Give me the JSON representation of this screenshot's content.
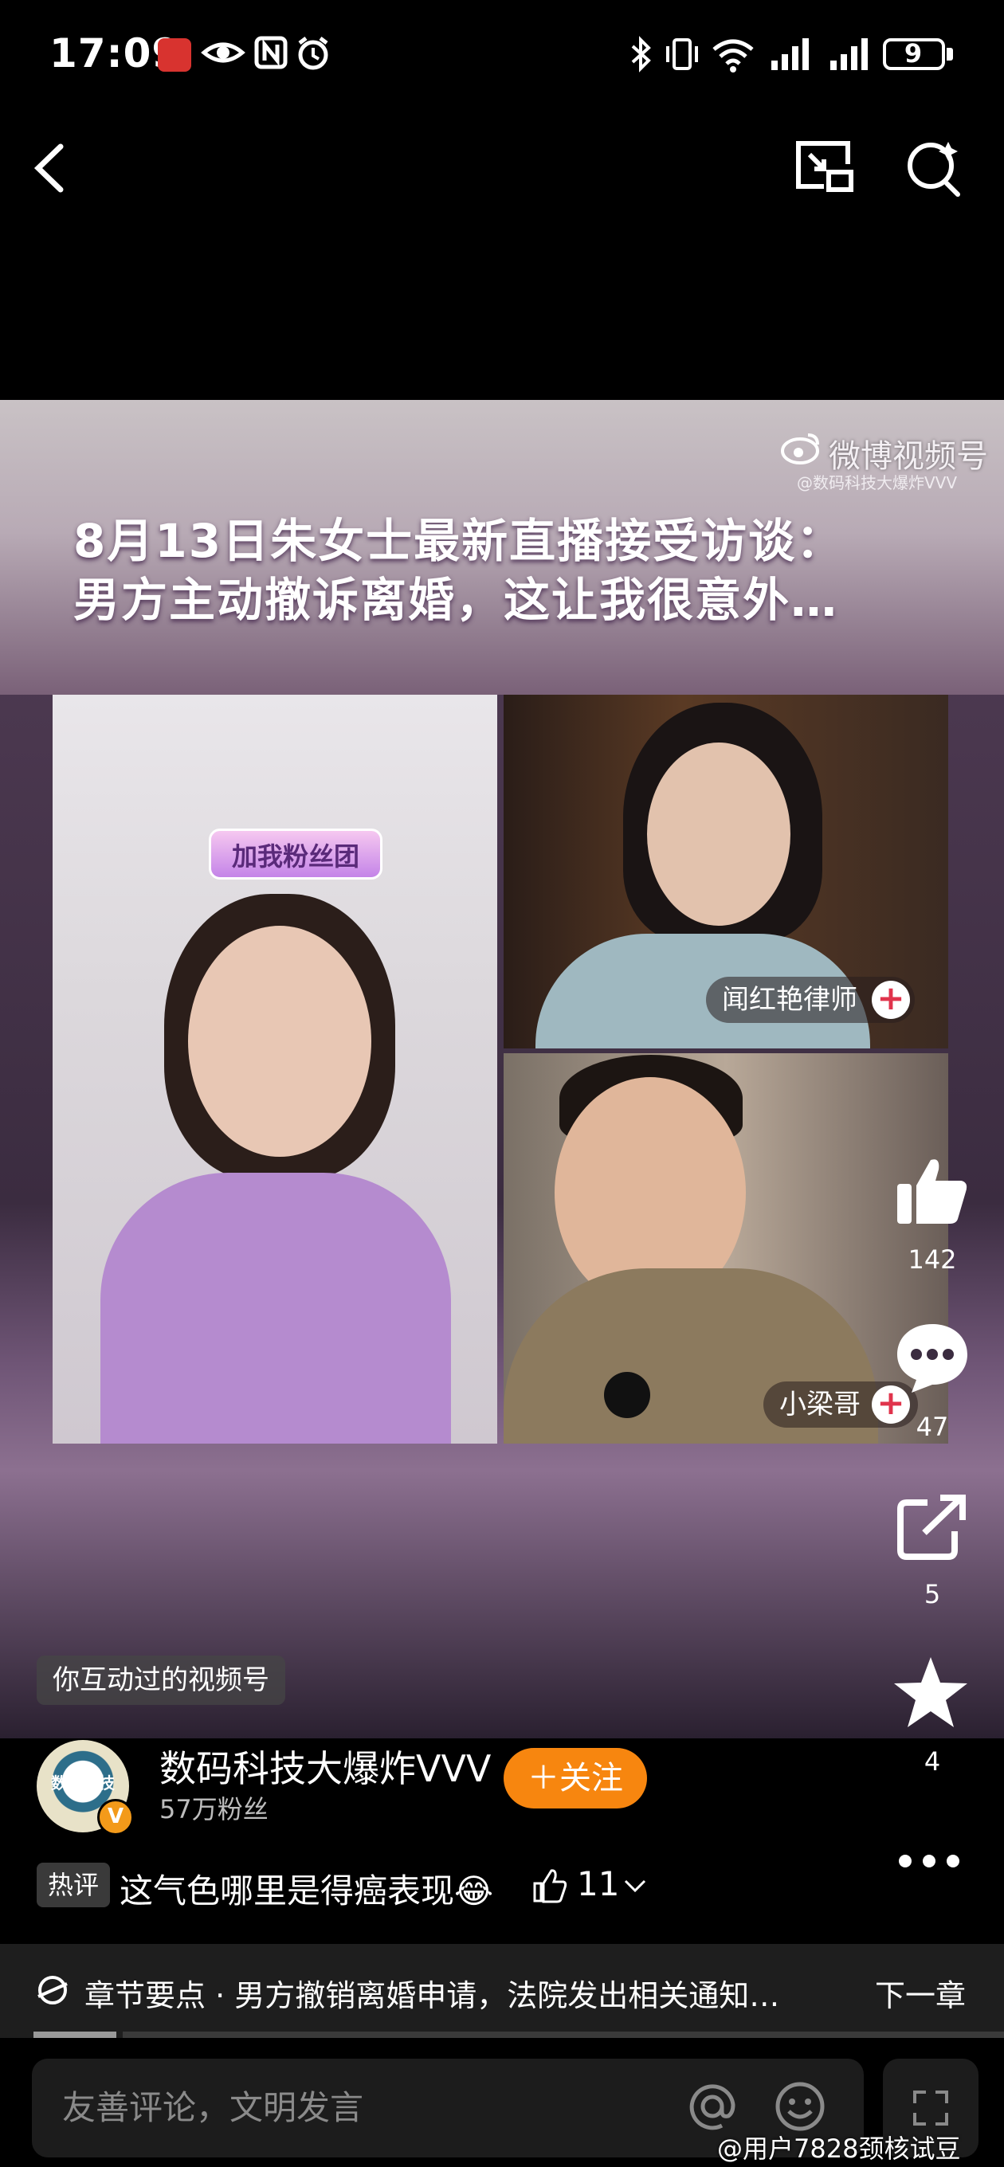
{
  "status_bar": {
    "time": "17:09",
    "battery_level": "9",
    "icons": [
      "app-notification-icon",
      "eye-icon",
      "nfc-icon",
      "alarm-icon",
      "bluetooth-icon",
      "vibrate-icon",
      "wifi-icon",
      "signal-icon",
      "signal-icon-2",
      "battery-icon"
    ]
  },
  "top_nav": {
    "back_icon": "chevron-left-icon",
    "pip_icon": "picture-in-picture-icon",
    "search_icon": "search-icon"
  },
  "video": {
    "watermark": "微博视频号",
    "watermark_sub": "@数码科技大爆炸VVV",
    "title_line1": "8月13日朱女士最新直播接受访谈：",
    "title_line2": "男方主动撤诉离婚，这让我很意外…",
    "fans_badge": "加我粉丝团",
    "guest1_name": "闻红艳律师",
    "guest2_name": "小梁哥",
    "plus": "+",
    "interacted_tag": "你互动过的视频号"
  },
  "actions": {
    "like_count": "142",
    "comment_count": "47",
    "share_count": "5",
    "favorite_count": "4"
  },
  "author": {
    "avatar_text": "数码科技",
    "verified": "V",
    "name": "数码科技大爆炸VVV",
    "fans": "57万粉丝",
    "follow_label": "＋关注"
  },
  "hot_comment": {
    "tag": "热评",
    "text": "这气色哪里是得癌表现😂",
    "likes": "11"
  },
  "chapter": {
    "text": "章节要点 · 男方撤销离婚申请，法院发出相关通知…",
    "next": "下一章"
  },
  "comment_bar": {
    "placeholder": "友善评论，文明发言"
  },
  "bottom_watermark": "@用户7828颈核试豆",
  "colors": {
    "follow": "#f7860f",
    "plus": "#e0344c"
  }
}
